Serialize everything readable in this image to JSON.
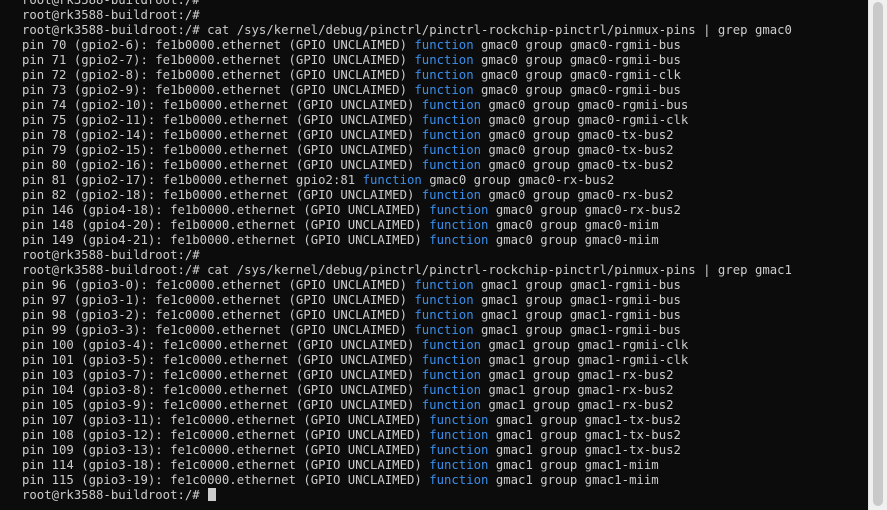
{
  "terminal": {
    "prompt": "root@rk3588-buildroot:/#",
    "command_gmac0": " cat /sys/kernel/debug/pinctrl/pinctrl-rockchip-pinctrl/pinmux-pins | grep gmac0",
    "command_gmac1": " cat /sys/kernel/debug/pinctrl/pinctrl-rockchip-pinctrl/pinmux-pins | grep gmac1",
    "function_keyword": "function",
    "gmac0_rows": [
      {
        "pre": "pin 70 (gpio2-6): fe1b0000.ethernet (GPIO UNCLAIMED) ",
        "post": " gmac0 group gmac0-rgmii-bus"
      },
      {
        "pre": "pin 71 (gpio2-7): fe1b0000.ethernet (GPIO UNCLAIMED) ",
        "post": " gmac0 group gmac0-rgmii-bus"
      },
      {
        "pre": "pin 72 (gpio2-8): fe1b0000.ethernet (GPIO UNCLAIMED) ",
        "post": " gmac0 group gmac0-rgmii-clk"
      },
      {
        "pre": "pin 73 (gpio2-9): fe1b0000.ethernet (GPIO UNCLAIMED) ",
        "post": " gmac0 group gmac0-rgmii-bus"
      },
      {
        "pre": "pin 74 (gpio2-10): fe1b0000.ethernet (GPIO UNCLAIMED) ",
        "post": " gmac0 group gmac0-rgmii-bus"
      },
      {
        "pre": "pin 75 (gpio2-11): fe1b0000.ethernet (GPIO UNCLAIMED) ",
        "post": " gmac0 group gmac0-rgmii-clk"
      },
      {
        "pre": "pin 78 (gpio2-14): fe1b0000.ethernet (GPIO UNCLAIMED) ",
        "post": " gmac0 group gmac0-tx-bus2"
      },
      {
        "pre": "pin 79 (gpio2-15): fe1b0000.ethernet (GPIO UNCLAIMED) ",
        "post": " gmac0 group gmac0-tx-bus2"
      },
      {
        "pre": "pin 80 (gpio2-16): fe1b0000.ethernet (GPIO UNCLAIMED) ",
        "post": " gmac0 group gmac0-tx-bus2"
      },
      {
        "pre": "pin 81 (gpio2-17): fe1b0000.ethernet gpio2:81 ",
        "post": " gmac0 group gmac0-rx-bus2"
      },
      {
        "pre": "pin 82 (gpio2-18): fe1b0000.ethernet (GPIO UNCLAIMED) ",
        "post": " gmac0 group gmac0-rx-bus2"
      },
      {
        "pre": "pin 146 (gpio4-18): fe1b0000.ethernet (GPIO UNCLAIMED) ",
        "post": " gmac0 group gmac0-rx-bus2"
      },
      {
        "pre": "pin 148 (gpio4-20): fe1b0000.ethernet (GPIO UNCLAIMED) ",
        "post": " gmac0 group gmac0-miim"
      },
      {
        "pre": "pin 149 (gpio4-21): fe1b0000.ethernet (GPIO UNCLAIMED) ",
        "post": " gmac0 group gmac0-miim"
      }
    ],
    "gmac1_rows": [
      {
        "pre": "pin 96 (gpio3-0): fe1c0000.ethernet (GPIO UNCLAIMED) ",
        "post": " gmac1 group gmac1-rgmii-bus"
      },
      {
        "pre": "pin 97 (gpio3-1): fe1c0000.ethernet (GPIO UNCLAIMED) ",
        "post": " gmac1 group gmac1-rgmii-bus"
      },
      {
        "pre": "pin 98 (gpio3-2): fe1c0000.ethernet (GPIO UNCLAIMED) ",
        "post": " gmac1 group gmac1-rgmii-bus"
      },
      {
        "pre": "pin 99 (gpio3-3): fe1c0000.ethernet (GPIO UNCLAIMED) ",
        "post": " gmac1 group gmac1-rgmii-bus"
      },
      {
        "pre": "pin 100 (gpio3-4): fe1c0000.ethernet (GPIO UNCLAIMED) ",
        "post": " gmac1 group gmac1-rgmii-clk"
      },
      {
        "pre": "pin 101 (gpio3-5): fe1c0000.ethernet (GPIO UNCLAIMED) ",
        "post": " gmac1 group gmac1-rgmii-clk"
      },
      {
        "pre": "pin 103 (gpio3-7): fe1c0000.ethernet (GPIO UNCLAIMED) ",
        "post": " gmac1 group gmac1-rx-bus2"
      },
      {
        "pre": "pin 104 (gpio3-8): fe1c0000.ethernet (GPIO UNCLAIMED) ",
        "post": " gmac1 group gmac1-rx-bus2"
      },
      {
        "pre": "pin 105 (gpio3-9): fe1c0000.ethernet (GPIO UNCLAIMED) ",
        "post": " gmac1 group gmac1-rx-bus2"
      },
      {
        "pre": "pin 107 (gpio3-11): fe1c0000.ethernet (GPIO UNCLAIMED) ",
        "post": " gmac1 group gmac1-tx-bus2"
      },
      {
        "pre": "pin 108 (gpio3-12): fe1c0000.ethernet (GPIO UNCLAIMED) ",
        "post": " gmac1 group gmac1-tx-bus2"
      },
      {
        "pre": "pin 109 (gpio3-13): fe1c0000.ethernet (GPIO UNCLAIMED) ",
        "post": " gmac1 group gmac1-tx-bus2"
      },
      {
        "pre": "pin 114 (gpio3-18): fe1c0000.ethernet (GPIO UNCLAIMED) ",
        "post": " gmac1 group gmac1-miim"
      },
      {
        "pre": "pin 115 (gpio3-19): fe1c0000.ethernet (GPIO UNCLAIMED) ",
        "post": " gmac1 group gmac1-miim"
      }
    ]
  },
  "colors": {
    "background": "#0c0c0c",
    "text": "#cccccc",
    "function_keyword": "#3b8eea",
    "scrollbar_track": "#f0f0f0",
    "scrollbar_thumb": "#c9c9c9"
  },
  "icons": {
    "cursor": "block-cursor-icon"
  }
}
